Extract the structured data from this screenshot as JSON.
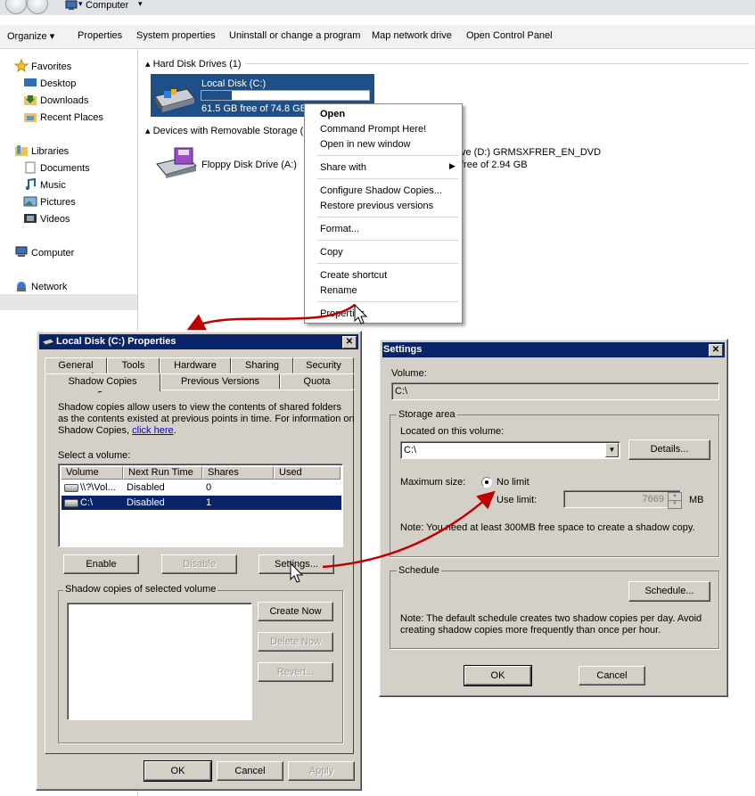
{
  "explorer": {
    "breadcrumb": "Computer",
    "toolbar": [
      "Organize",
      "Properties",
      "System properties",
      "Uninstall or change a program",
      "Map network drive",
      "Open Control Panel"
    ],
    "nav": {
      "favorites": "Favorites",
      "desktop": "Desktop",
      "downloads": "Downloads",
      "recent": "Recent Places",
      "libraries": "Libraries",
      "documents": "Documents",
      "music": "Music",
      "pictures": "Pictures",
      "videos": "Videos",
      "computer": "Computer",
      "network": "Network"
    },
    "groups": {
      "hdd": "Hard Disk Drives (1)",
      "removable": "Devices with Removable Storage (2"
    },
    "disk_c": {
      "name": "Local Disk (C:)",
      "free": "61.5 GB free of 74.8 GB",
      "used_fraction": 0.18
    },
    "floppy": {
      "name": "Floppy Disk Drive (A:)"
    },
    "dvd": {
      "name": "ve (D:) GRMSXFRER_EN_DVD",
      "free": "free of 2.94 GB"
    }
  },
  "context_menu": {
    "open": "Open",
    "cmd": "Command Prompt Here!",
    "new_window": "Open in new window",
    "share_with": "Share with",
    "shadow": "Configure Shadow Copies...",
    "restore": "Restore previous versions",
    "format": "Format...",
    "copy": "Copy",
    "shortcut": "Create shortcut",
    "rename": "Rename",
    "properties": "Properties"
  },
  "props": {
    "title": "Local Disk (C:) Properties",
    "tabs_row1": [
      "General",
      "Tools",
      "Hardware",
      "Sharing",
      "Security"
    ],
    "tabs_row2": [
      "Shadow Copies",
      "Previous Versions",
      "Quota"
    ],
    "description": [
      "Shadow copies allow users to view the contents of shared folders",
      "as the contents existed at previous points in time. For information on",
      "Shadow Copies, "
    ],
    "link": "click here",
    "link_tail": ".",
    "select_volume": "Select a volume:",
    "columns": [
      "Volume",
      "Next Run Time",
      "Shares",
      "Used"
    ],
    "rows": [
      {
        "volume": "\\\\?\\Vol...",
        "next": "Disabled",
        "shares": "0",
        "used": ""
      },
      {
        "volume": "C:\\",
        "next": "Disabled",
        "shares": "1",
        "used": ""
      }
    ],
    "enable": "Enable",
    "disable": "Disable",
    "settings": "Settings...",
    "group_label": "Shadow copies of selected volume",
    "create_now": "Create Now",
    "delete_now": "Delete Now",
    "revert": "Revert...",
    "ok": "OK",
    "cancel": "Cancel",
    "apply": "Apply"
  },
  "settings": {
    "title": "Settings",
    "volume_label": "Volume:",
    "volume_value": "C:\\",
    "storage_area": "Storage area",
    "located_label": "Located on this volume:",
    "located_value": "C:\\",
    "details": "Details...",
    "max_size": "Maximum size:",
    "no_limit": "No limit",
    "use_limit": "Use limit:",
    "limit_value": "7669",
    "unit": "MB",
    "note1": "Note: You need at least 300MB free space to create a shadow copy.",
    "schedule_label": "Schedule",
    "schedule_btn": "Schedule...",
    "note2": [
      "Note: The default schedule creates two shadow copies per day. Avoid",
      "creating shadow copies more frequently than once per hour."
    ],
    "ok": "OK",
    "cancel": "Cancel"
  },
  "colors": {
    "title_bar": "#0a246a",
    "dialog_face": "#d4d0c8",
    "annotation_arrow": "#c00000",
    "selection": "#0a246a"
  }
}
